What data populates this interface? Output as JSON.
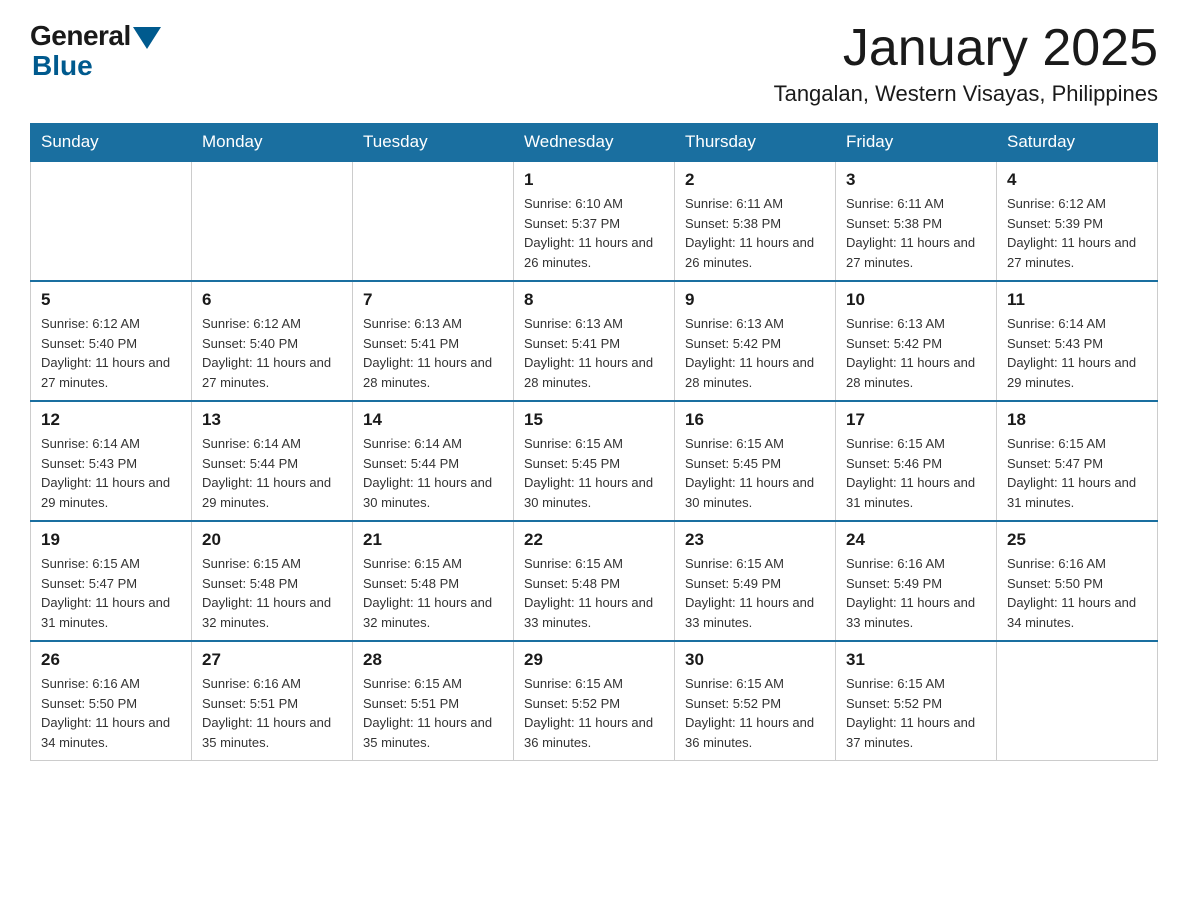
{
  "header": {
    "logo_general": "General",
    "logo_blue": "Blue",
    "month_title": "January 2025",
    "location": "Tangalan, Western Visayas, Philippines"
  },
  "days_of_week": [
    "Sunday",
    "Monday",
    "Tuesday",
    "Wednesday",
    "Thursday",
    "Friday",
    "Saturday"
  ],
  "weeks": [
    [
      {
        "day": "",
        "info": ""
      },
      {
        "day": "",
        "info": ""
      },
      {
        "day": "",
        "info": ""
      },
      {
        "day": "1",
        "info": "Sunrise: 6:10 AM\nSunset: 5:37 PM\nDaylight: 11 hours and 26 minutes."
      },
      {
        "day": "2",
        "info": "Sunrise: 6:11 AM\nSunset: 5:38 PM\nDaylight: 11 hours and 26 minutes."
      },
      {
        "day": "3",
        "info": "Sunrise: 6:11 AM\nSunset: 5:38 PM\nDaylight: 11 hours and 27 minutes."
      },
      {
        "day": "4",
        "info": "Sunrise: 6:12 AM\nSunset: 5:39 PM\nDaylight: 11 hours and 27 minutes."
      }
    ],
    [
      {
        "day": "5",
        "info": "Sunrise: 6:12 AM\nSunset: 5:40 PM\nDaylight: 11 hours and 27 minutes."
      },
      {
        "day": "6",
        "info": "Sunrise: 6:12 AM\nSunset: 5:40 PM\nDaylight: 11 hours and 27 minutes."
      },
      {
        "day": "7",
        "info": "Sunrise: 6:13 AM\nSunset: 5:41 PM\nDaylight: 11 hours and 28 minutes."
      },
      {
        "day": "8",
        "info": "Sunrise: 6:13 AM\nSunset: 5:41 PM\nDaylight: 11 hours and 28 minutes."
      },
      {
        "day": "9",
        "info": "Sunrise: 6:13 AM\nSunset: 5:42 PM\nDaylight: 11 hours and 28 minutes."
      },
      {
        "day": "10",
        "info": "Sunrise: 6:13 AM\nSunset: 5:42 PM\nDaylight: 11 hours and 28 minutes."
      },
      {
        "day": "11",
        "info": "Sunrise: 6:14 AM\nSunset: 5:43 PM\nDaylight: 11 hours and 29 minutes."
      }
    ],
    [
      {
        "day": "12",
        "info": "Sunrise: 6:14 AM\nSunset: 5:43 PM\nDaylight: 11 hours and 29 minutes."
      },
      {
        "day": "13",
        "info": "Sunrise: 6:14 AM\nSunset: 5:44 PM\nDaylight: 11 hours and 29 minutes."
      },
      {
        "day": "14",
        "info": "Sunrise: 6:14 AM\nSunset: 5:44 PM\nDaylight: 11 hours and 30 minutes."
      },
      {
        "day": "15",
        "info": "Sunrise: 6:15 AM\nSunset: 5:45 PM\nDaylight: 11 hours and 30 minutes."
      },
      {
        "day": "16",
        "info": "Sunrise: 6:15 AM\nSunset: 5:45 PM\nDaylight: 11 hours and 30 minutes."
      },
      {
        "day": "17",
        "info": "Sunrise: 6:15 AM\nSunset: 5:46 PM\nDaylight: 11 hours and 31 minutes."
      },
      {
        "day": "18",
        "info": "Sunrise: 6:15 AM\nSunset: 5:47 PM\nDaylight: 11 hours and 31 minutes."
      }
    ],
    [
      {
        "day": "19",
        "info": "Sunrise: 6:15 AM\nSunset: 5:47 PM\nDaylight: 11 hours and 31 minutes."
      },
      {
        "day": "20",
        "info": "Sunrise: 6:15 AM\nSunset: 5:48 PM\nDaylight: 11 hours and 32 minutes."
      },
      {
        "day": "21",
        "info": "Sunrise: 6:15 AM\nSunset: 5:48 PM\nDaylight: 11 hours and 32 minutes."
      },
      {
        "day": "22",
        "info": "Sunrise: 6:15 AM\nSunset: 5:48 PM\nDaylight: 11 hours and 33 minutes."
      },
      {
        "day": "23",
        "info": "Sunrise: 6:15 AM\nSunset: 5:49 PM\nDaylight: 11 hours and 33 minutes."
      },
      {
        "day": "24",
        "info": "Sunrise: 6:16 AM\nSunset: 5:49 PM\nDaylight: 11 hours and 33 minutes."
      },
      {
        "day": "25",
        "info": "Sunrise: 6:16 AM\nSunset: 5:50 PM\nDaylight: 11 hours and 34 minutes."
      }
    ],
    [
      {
        "day": "26",
        "info": "Sunrise: 6:16 AM\nSunset: 5:50 PM\nDaylight: 11 hours and 34 minutes."
      },
      {
        "day": "27",
        "info": "Sunrise: 6:16 AM\nSunset: 5:51 PM\nDaylight: 11 hours and 35 minutes."
      },
      {
        "day": "28",
        "info": "Sunrise: 6:15 AM\nSunset: 5:51 PM\nDaylight: 11 hours and 35 minutes."
      },
      {
        "day": "29",
        "info": "Sunrise: 6:15 AM\nSunset: 5:52 PM\nDaylight: 11 hours and 36 minutes."
      },
      {
        "day": "30",
        "info": "Sunrise: 6:15 AM\nSunset: 5:52 PM\nDaylight: 11 hours and 36 minutes."
      },
      {
        "day": "31",
        "info": "Sunrise: 6:15 AM\nSunset: 5:52 PM\nDaylight: 11 hours and 37 minutes."
      },
      {
        "day": "",
        "info": ""
      }
    ]
  ]
}
